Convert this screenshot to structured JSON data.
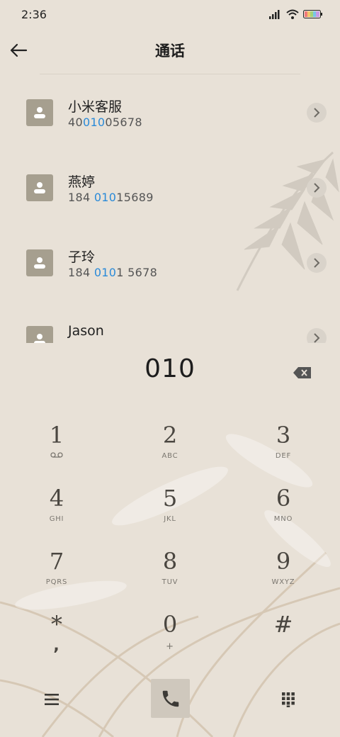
{
  "status_bar": {
    "time": "2:36",
    "icons": [
      "signal-icon",
      "wifi-icon",
      "battery-icon"
    ]
  },
  "header": {
    "title": "通话",
    "back_icon": "arrow-left-icon"
  },
  "results": [
    {
      "name": "小米客服",
      "number_parts": [
        "40",
        "010",
        "05678"
      ]
    },
    {
      "name": "燕婷",
      "number_parts": [
        "184 ",
        "010",
        "15689"
      ]
    },
    {
      "name": "子玲",
      "number_parts": [
        "184 ",
        "010",
        "1 5678"
      ]
    },
    {
      "name": "Jason",
      "number_parts": [
        "",
        "",
        ""
      ]
    }
  ],
  "dial_input": "010",
  "keypad": [
    {
      "digit": "1",
      "letters": "voicemail-icon"
    },
    {
      "digit": "2",
      "letters": "ABC"
    },
    {
      "digit": "3",
      "letters": "DEF"
    },
    {
      "digit": "4",
      "letters": "GHI"
    },
    {
      "digit": "5",
      "letters": "JKL"
    },
    {
      "digit": "6",
      "letters": "MNO"
    },
    {
      "digit": "7",
      "letters": "PQRS"
    },
    {
      "digit": "8",
      "letters": "TUV"
    },
    {
      "digit": "9",
      "letters": "WXYZ"
    },
    {
      "digit": "*",
      "letters": ","
    },
    {
      "digit": "0",
      "letters": "+"
    },
    {
      "digit": "#",
      "letters": ""
    }
  ],
  "colors": {
    "background": "#e8e1d7",
    "highlight": "#2a8ad8",
    "avatar": "#a69f8f"
  }
}
